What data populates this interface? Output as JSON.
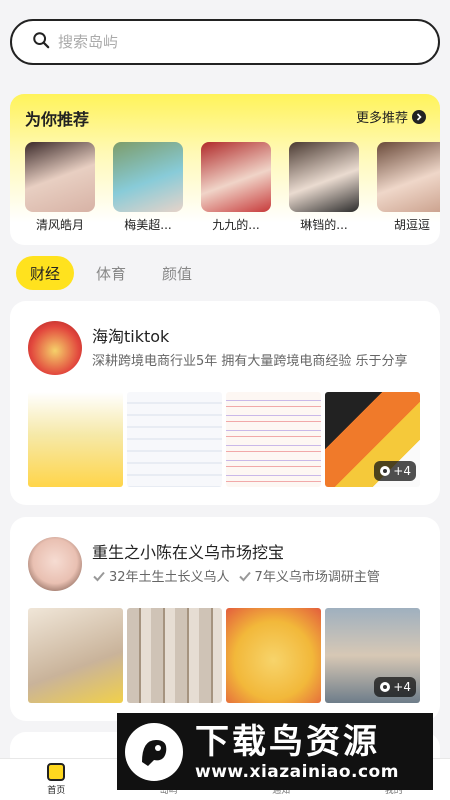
{
  "search": {
    "placeholder": "搜索岛屿"
  },
  "recommend": {
    "title": "为你推荐",
    "more_label": "更多推荐",
    "items": [
      {
        "name": "清风皓月",
        "color": "#c9a59a"
      },
      {
        "name": "梅美超...",
        "color": "#7fb8c8"
      },
      {
        "name": "九九的...",
        "color": "#c24a4a"
      },
      {
        "name": "琳铛的...",
        "color": "#8a6f62"
      },
      {
        "name": "胡逗逗",
        "color": "#b9876f"
      }
    ]
  },
  "tabs": [
    {
      "label": "财经",
      "active": true
    },
    {
      "label": "体育",
      "active": false
    },
    {
      "label": "颜值",
      "active": false
    }
  ],
  "posts": [
    {
      "name": "海淘tiktok",
      "desc": "深耕跨境电商行业5年 拥有大量跨境电商经验 乐于分享",
      "badge": "+4",
      "images": [
        "#f3e9c6",
        "#eef1f6",
        "#f5eee8",
        "#f2f2f2"
      ]
    },
    {
      "name": "重生之小陈在义乌市场挖宝",
      "tags": [
        "32年土生土长义乌人",
        "7年义乌市场调研主管"
      ],
      "badge": "+4",
      "images": [
        "#e9ddc9",
        "#d8cfc4",
        "#f4c84a",
        "#b8c4cf"
      ]
    }
  ],
  "nav": [
    {
      "label": "首页",
      "active": true
    },
    {
      "label": "岛屿",
      "active": false
    },
    {
      "label": "通知",
      "active": false
    },
    {
      "label": "我的",
      "active": false
    }
  ],
  "watermark": {
    "title": "下载鸟资源",
    "url": "www.xiazainiao.com"
  },
  "colors": {
    "accent": "#ffe21e",
    "text": "#222222",
    "muted": "#888888"
  }
}
